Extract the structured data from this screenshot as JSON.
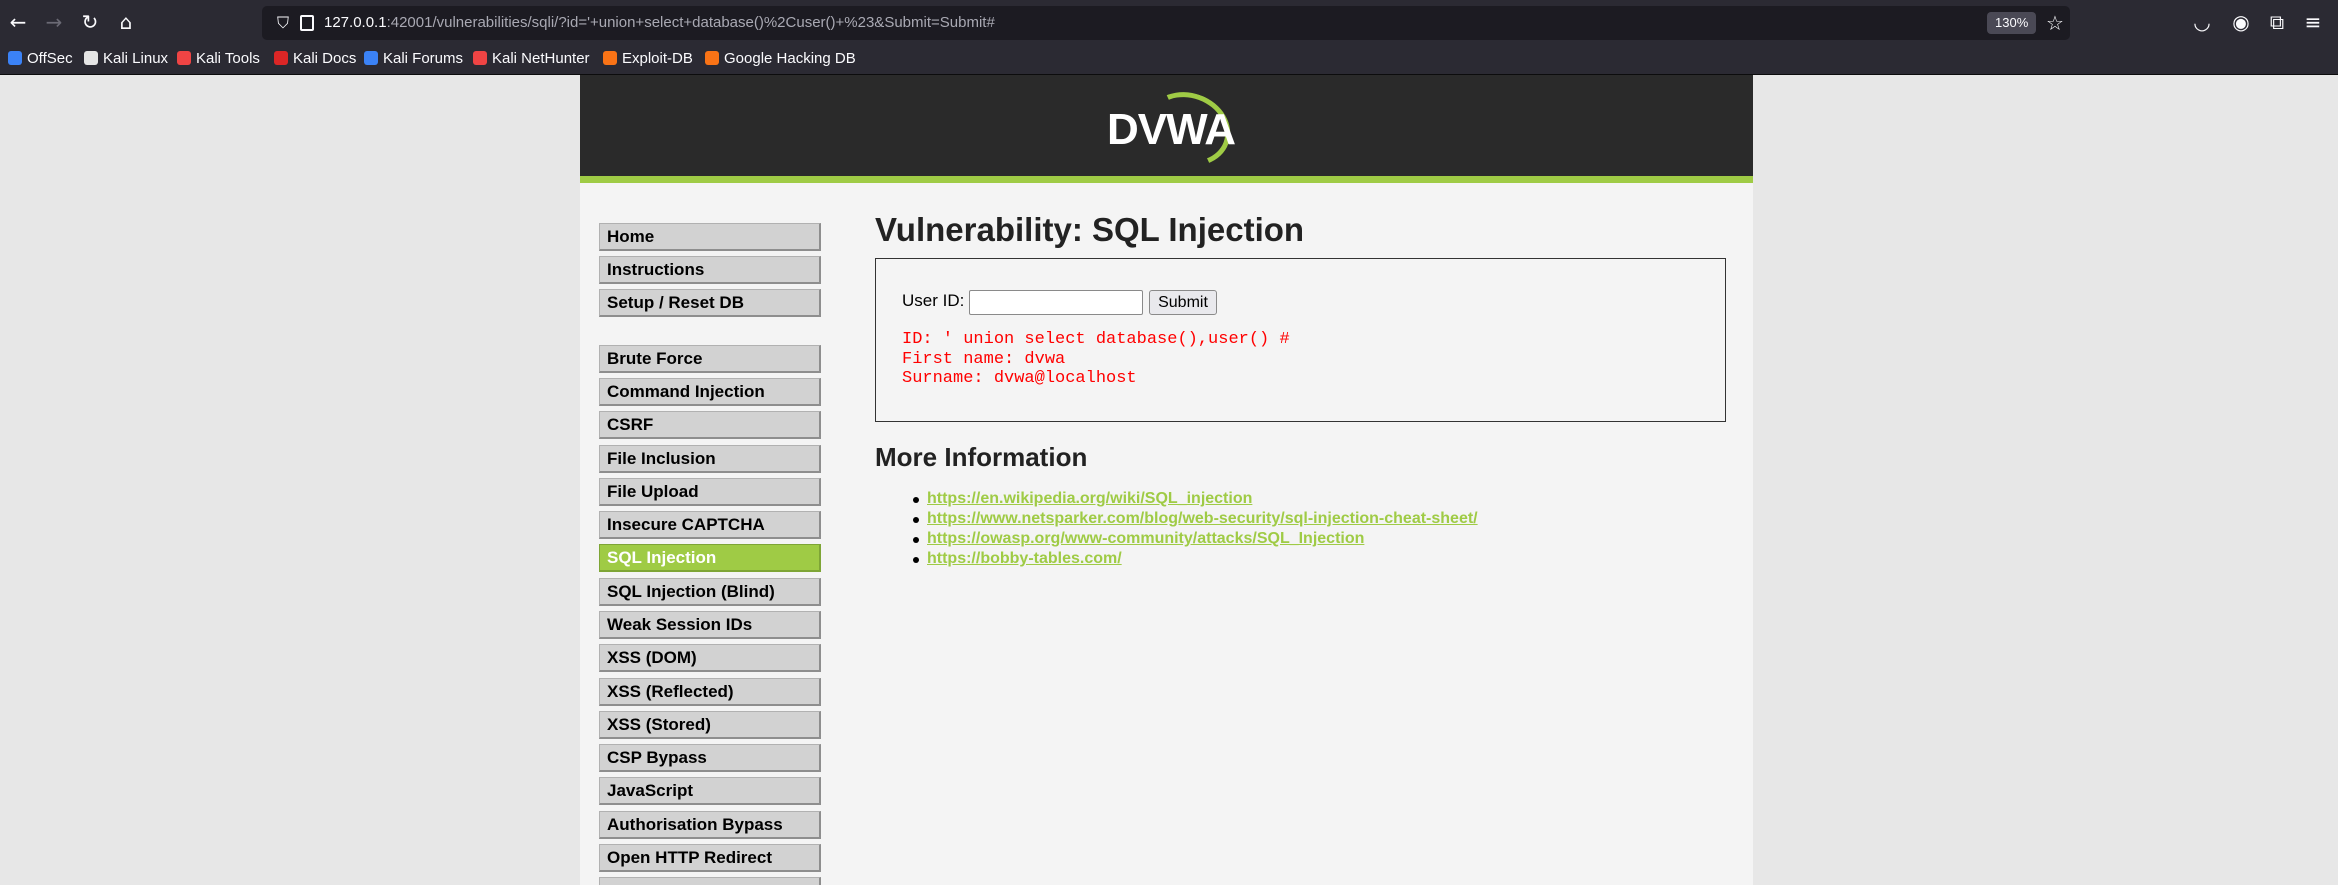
{
  "browser": {
    "url_host": "127.0.0.1",
    "url_rest": ":42001/vulnerabilities/sqli/?id='+union+select+database()%2Cuser()+%23&Submit=Submit#",
    "zoom": "130%",
    "icons": {
      "back": "←",
      "forward": "→",
      "reload": "↻",
      "home": "⌂",
      "shield": "⛉",
      "star": "☆",
      "pocket": "◡",
      "account": "◉",
      "extensions": "⧉",
      "menu": "≡"
    },
    "bookmarks": [
      {
        "label": "OffSec",
        "color": "#3b82f6"
      },
      {
        "label": "Kali Linux",
        "color": "#e5e5e5"
      },
      {
        "label": "Kali Tools",
        "color": "#ef4444"
      },
      {
        "label": "Kali Docs",
        "color": "#dc2626"
      },
      {
        "label": "Kali Forums",
        "color": "#3b82f6"
      },
      {
        "label": "Kali NetHunter",
        "color": "#ef4444"
      },
      {
        "label": "Exploit-DB",
        "color": "#f97316"
      },
      {
        "label": "Google Hacking DB",
        "color": "#f97316"
      }
    ]
  },
  "logo": {
    "text": "DVWA"
  },
  "menu": {
    "items": [
      {
        "label": "Home"
      },
      {
        "label": "Instructions"
      },
      {
        "label": "Setup / Reset DB"
      },
      {
        "label": "Brute Force"
      },
      {
        "label": "Command Injection"
      },
      {
        "label": "CSRF"
      },
      {
        "label": "File Inclusion"
      },
      {
        "label": "File Upload"
      },
      {
        "label": "Insecure CAPTCHA"
      },
      {
        "label": "SQL Injection"
      },
      {
        "label": "SQL Injection (Blind)"
      },
      {
        "label": "Weak Session IDs"
      },
      {
        "label": "XSS (DOM)"
      },
      {
        "label": "XSS (Reflected)"
      },
      {
        "label": "XSS (Stored)"
      },
      {
        "label": "CSP Bypass"
      },
      {
        "label": "JavaScript"
      },
      {
        "label": "Authorisation Bypass"
      },
      {
        "label": "Open HTTP Redirect"
      }
    ],
    "active": "SQL Injection"
  },
  "main": {
    "title": "Vulnerability: SQL Injection",
    "form": {
      "label": "User ID:",
      "input_value": "",
      "submit_label": "Submit"
    },
    "result_lines": [
      "ID: ' union select database(),user() #",
      "First name: dvwa",
      "Surname: dvwa@localhost"
    ],
    "more_title": "More Information",
    "links": [
      "https://en.wikipedia.org/wiki/SQL_injection",
      "https://www.netsparker.com/blog/web-security/sql-injection-cheat-sheet/",
      "https://owasp.org/www-community/attacks/SQL_Injection",
      "https://bobby-tables.com/"
    ]
  },
  "colors": {
    "accent": "#9fcb45",
    "result": "#ff0000",
    "header_bg": "#2a2a2a"
  }
}
